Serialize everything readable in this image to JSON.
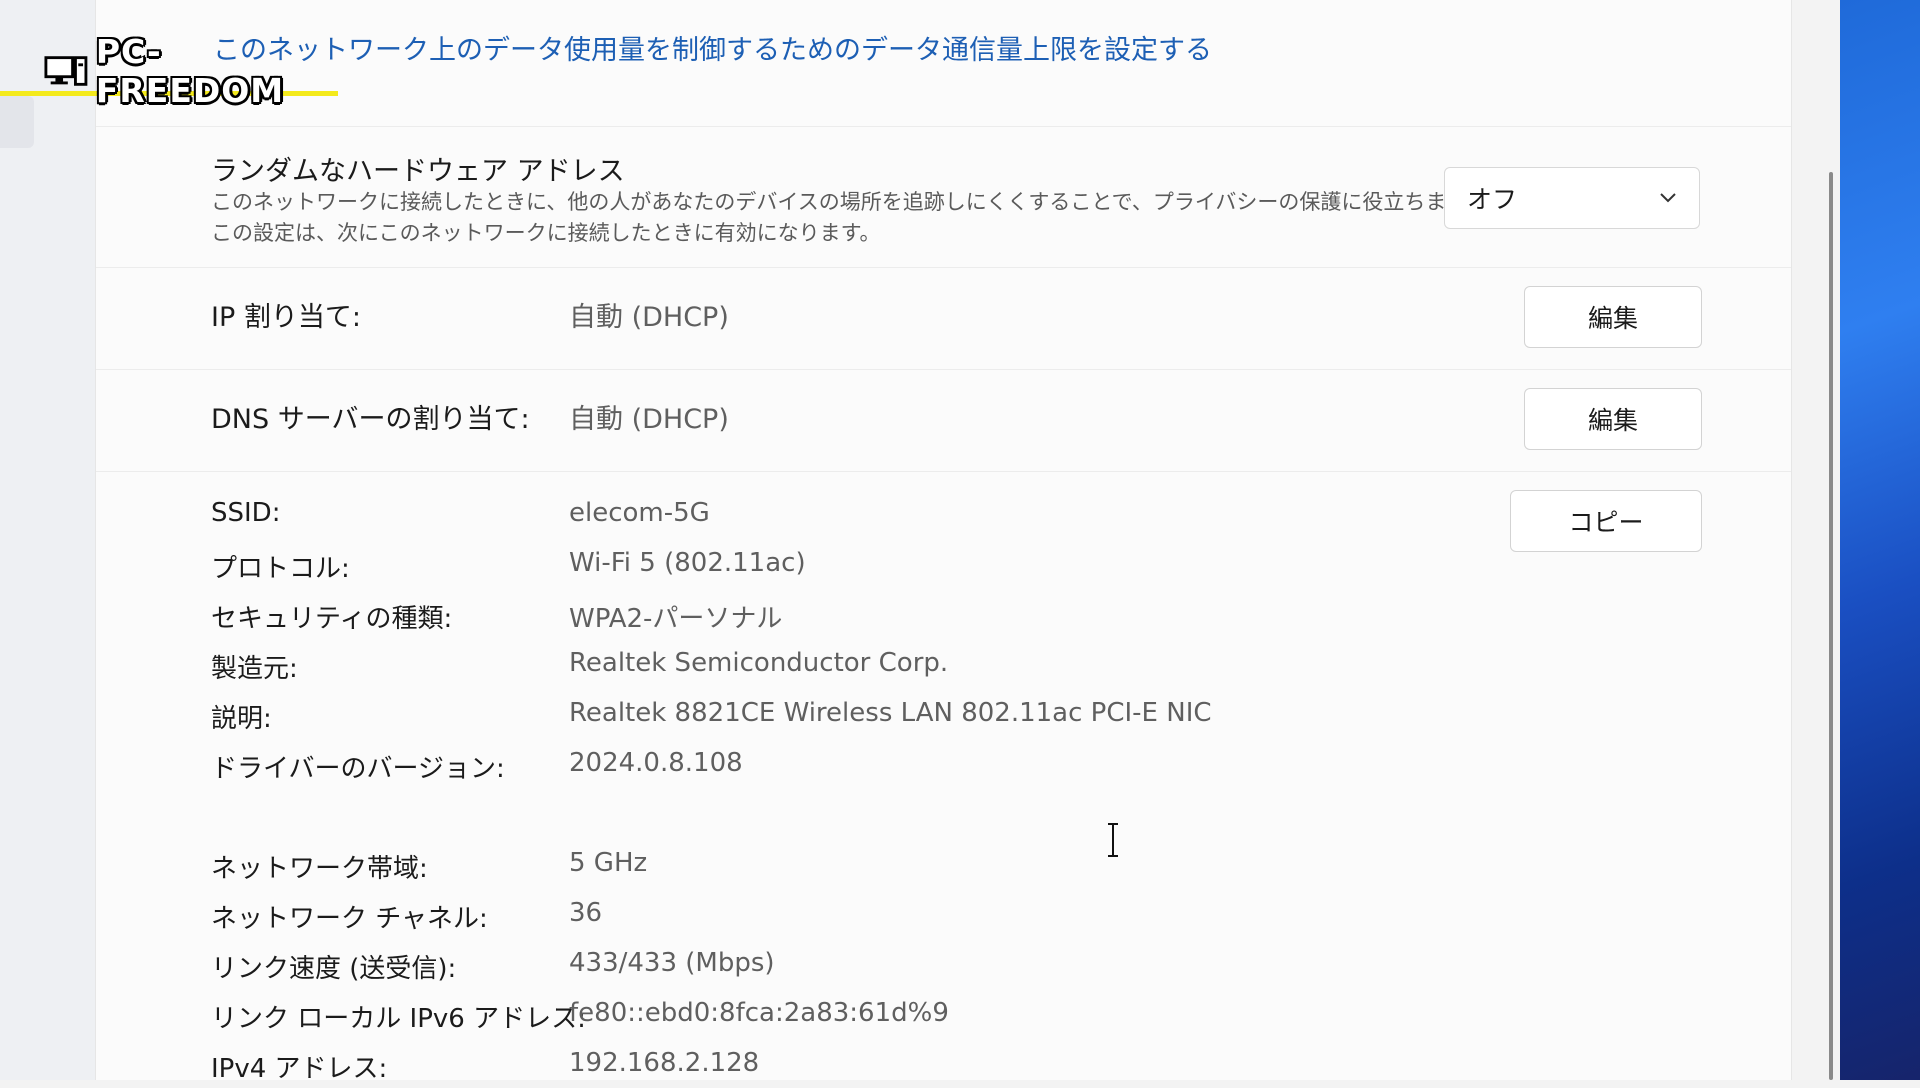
{
  "watermark": {
    "text": "PC-FREEDOM"
  },
  "data_limit_link": "このネットワーク上のデータ使用量を制御するためのデータ通信量上限を設定する",
  "random_hw": {
    "title": "ランダムなハードウェア アドレス",
    "description": "このネットワークに接続したときに、他の人があなたのデバイスの場所を追跡しにくくすることで、プライバシーの保護に役立ちます。この設定は、次にこのネットワークに接続したときに有効になります。",
    "dropdown_value": "オフ",
    "dropdown_icon": "chevron-down-icon"
  },
  "ip_assignment": {
    "label": "IP 割り当て:",
    "value": "自動 (DHCP)",
    "button": "編集"
  },
  "dns_assignment": {
    "label": "DNS サーバーの割り当て:",
    "value": "自動 (DHCP)",
    "button": "編集"
  },
  "properties": {
    "copy_button": "コピー",
    "items": [
      {
        "label": "SSID:",
        "value": "elecom-5G"
      },
      {
        "label": "プロトコル:",
        "value": "Wi-Fi 5 (802.11ac)"
      },
      {
        "label": "セキュリティの種類:",
        "value": "WPA2-パーソナル"
      },
      {
        "label": "製造元:",
        "value": "Realtek Semiconductor Corp."
      },
      {
        "label": "説明:",
        "value": "Realtek 8821CE Wireless LAN 802.11ac PCI-E NIC"
      },
      {
        "label": "ドライバーのバージョン:",
        "value": "2024.0.8.108"
      },
      {
        "label": "ネットワーク帯域:",
        "value": "5 GHz"
      },
      {
        "label": "ネットワーク チャネル:",
        "value": "36"
      },
      {
        "label": "リンク速度 (送受信):",
        "value": "433/433 (Mbps)"
      },
      {
        "label": "リンク ローカル IPv6 アドレス:",
        "value": "fe80::ebd0:8fca:2a83:61d%9"
      },
      {
        "label": "IPv4 アドレス:",
        "value": "192.168.2.128"
      }
    ]
  }
}
